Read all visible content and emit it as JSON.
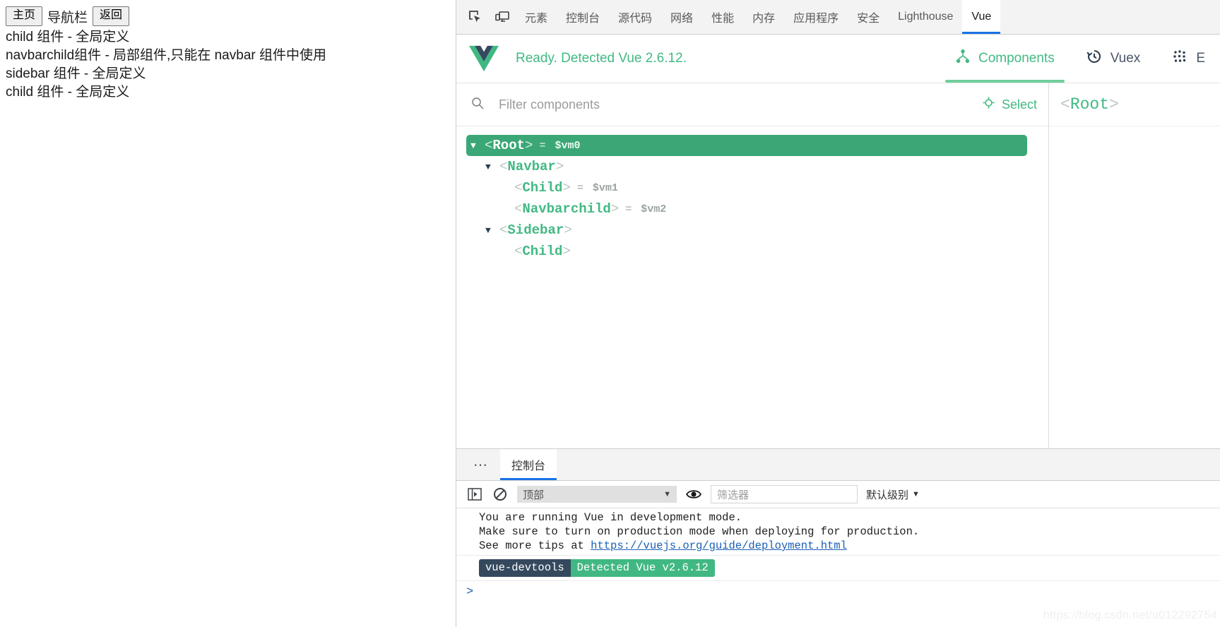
{
  "webpage": {
    "nav": {
      "home_button": "主页",
      "title": "导航栏",
      "back_button": "返回"
    },
    "lines": [
      "child 组件 - 全局定义",
      "navbarchild组件 - 局部组件,只能在 navbar 组件中使用",
      "sidebar 组件 - 全局定义",
      "child 组件 - 全局定义"
    ]
  },
  "devtools": {
    "toolbar_icons": [
      {
        "name": "inspect-element-icon"
      },
      {
        "name": "device-toolbar-icon"
      }
    ],
    "tabs": [
      {
        "label": "元素",
        "active": false
      },
      {
        "label": "控制台",
        "active": false
      },
      {
        "label": "源代码",
        "active": false
      },
      {
        "label": "网络",
        "active": false
      },
      {
        "label": "性能",
        "active": false
      },
      {
        "label": "内存",
        "active": false
      },
      {
        "label": "应用程序",
        "active": false
      },
      {
        "label": "安全",
        "active": false
      },
      {
        "label": "Lighthouse",
        "active": false
      },
      {
        "label": "Vue",
        "active": true
      }
    ],
    "active_tab_accent": "#1a73e8"
  },
  "vue_panel": {
    "status": "Ready. Detected Vue 2.6.12.",
    "accent": "#42b983",
    "modes": [
      {
        "label": "Components",
        "icon": "components-tree-icon",
        "active": true
      },
      {
        "label": "Vuex",
        "icon": "history-clock-icon",
        "active": false
      },
      {
        "label": "E",
        "icon": "events-dots-icon",
        "active": false
      }
    ],
    "filter": {
      "placeholder": "Filter components",
      "value": "",
      "icon": "search-icon"
    },
    "select_button": {
      "label": "Select",
      "icon": "target-select-icon"
    },
    "tree": [
      {
        "tag": "Root",
        "depth": 0,
        "expandable": true,
        "expanded": true,
        "vm": "$vm0",
        "selected": true
      },
      {
        "tag": "Navbar",
        "depth": 1,
        "expandable": true,
        "expanded": true,
        "vm": "",
        "selected": false
      },
      {
        "tag": "Child",
        "depth": 2,
        "expandable": false,
        "expanded": false,
        "vm": "$vm1",
        "selected": false
      },
      {
        "tag": "Navbarchild",
        "depth": 2,
        "expandable": false,
        "expanded": false,
        "vm": "$vm2",
        "selected": false
      },
      {
        "tag": "Sidebar",
        "depth": 1,
        "expandable": true,
        "expanded": true,
        "vm": "",
        "selected": false
      },
      {
        "tag": "Child",
        "depth": 2,
        "expandable": false,
        "expanded": false,
        "vm": "",
        "selected": false
      }
    ],
    "inspector_title": "<Root>"
  },
  "drawer": {
    "more_icon": "more-tabs-icon",
    "tabs": [
      {
        "label": "控制台",
        "active": true
      }
    ],
    "console_toolbar": {
      "sidebar_icon": "console-sidebar-icon",
      "clear_icon": "clear-console-icon",
      "context": "顶部",
      "eye_icon": "live-expression-icon",
      "filter_placeholder": "筛选器",
      "filter_value": "",
      "level": "默认级别"
    },
    "messages": [
      {
        "type": "text",
        "lines": [
          "You are running Vue in development mode.",
          "Make sure to turn on production mode when deploying for production.",
          "See more tips at "
        ],
        "link": "https://vuejs.org/guide/deployment.html"
      },
      {
        "type": "badge",
        "left": "vue-devtools",
        "left_color": "#35495e",
        "right": "Detected Vue v2.6.12",
        "right_color": "#41b883"
      }
    ],
    "prompt": ">"
  },
  "watermark": "https://blog.csdn.net/u012292754"
}
